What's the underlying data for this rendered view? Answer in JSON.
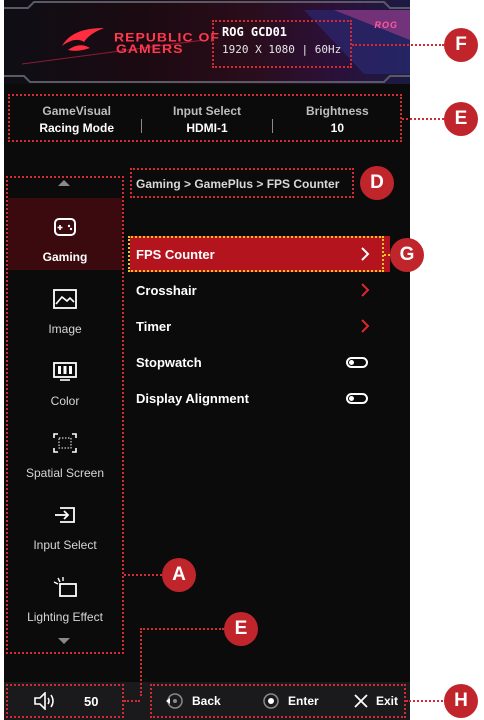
{
  "header": {
    "brand_line1": "REPUBLIC OF",
    "brand_line2": "GAMERS",
    "model_name": "ROG GCD01",
    "model_resolution": "1920 X 1080 | 60Hz",
    "corner_tag": "ROG"
  },
  "status": {
    "gamevisual_label": "GameVisual",
    "gamevisual_value": "Racing Mode",
    "input_label": "Input Select",
    "input_value": "HDMI-1",
    "brightness_label": "Brightness",
    "brightness_value": "10"
  },
  "sidebar": {
    "items": [
      {
        "label": "Gaming",
        "icon": "gamepad-icon",
        "active": true
      },
      {
        "label": "Image",
        "icon": "image-icon",
        "active": false
      },
      {
        "label": "Color",
        "icon": "color-icon",
        "active": false
      },
      {
        "label": "Spatial Screen",
        "icon": "spatial-screen-icon",
        "active": false
      },
      {
        "label": "Input Select",
        "icon": "input-select-icon",
        "active": false
      },
      {
        "label": "Lighting Effect",
        "icon": "lighting-effect-icon",
        "active": false
      }
    ]
  },
  "breadcrumb": "Gaming > GamePlus > FPS Counter",
  "menu": {
    "items": [
      {
        "label": "FPS Counter",
        "control": "chevron-right-icon",
        "selected": true
      },
      {
        "label": "Crosshair",
        "control": "chevron-right-icon",
        "selected": false
      },
      {
        "label": "Timer",
        "control": "chevron-right-icon",
        "selected": false
      },
      {
        "label": "Stopwatch",
        "control": "toggle-icon",
        "state": "off"
      },
      {
        "label": "Display Alignment",
        "control": "toggle-icon",
        "state": "off"
      }
    ]
  },
  "footer": {
    "volume_value": "50",
    "back_label": "Back",
    "enter_label": "Enter",
    "exit_label": "Exit"
  },
  "annotations": {
    "a": "A",
    "d": "D",
    "e1": "E",
    "e2": "E",
    "f": "F",
    "g": "G",
    "h": "H"
  },
  "colors": {
    "accent": "#b4141e",
    "brand_red": "#ff3a4e",
    "marker": "#c1252c",
    "highlight": "#f3c21b",
    "background": "#0b0b0c"
  }
}
